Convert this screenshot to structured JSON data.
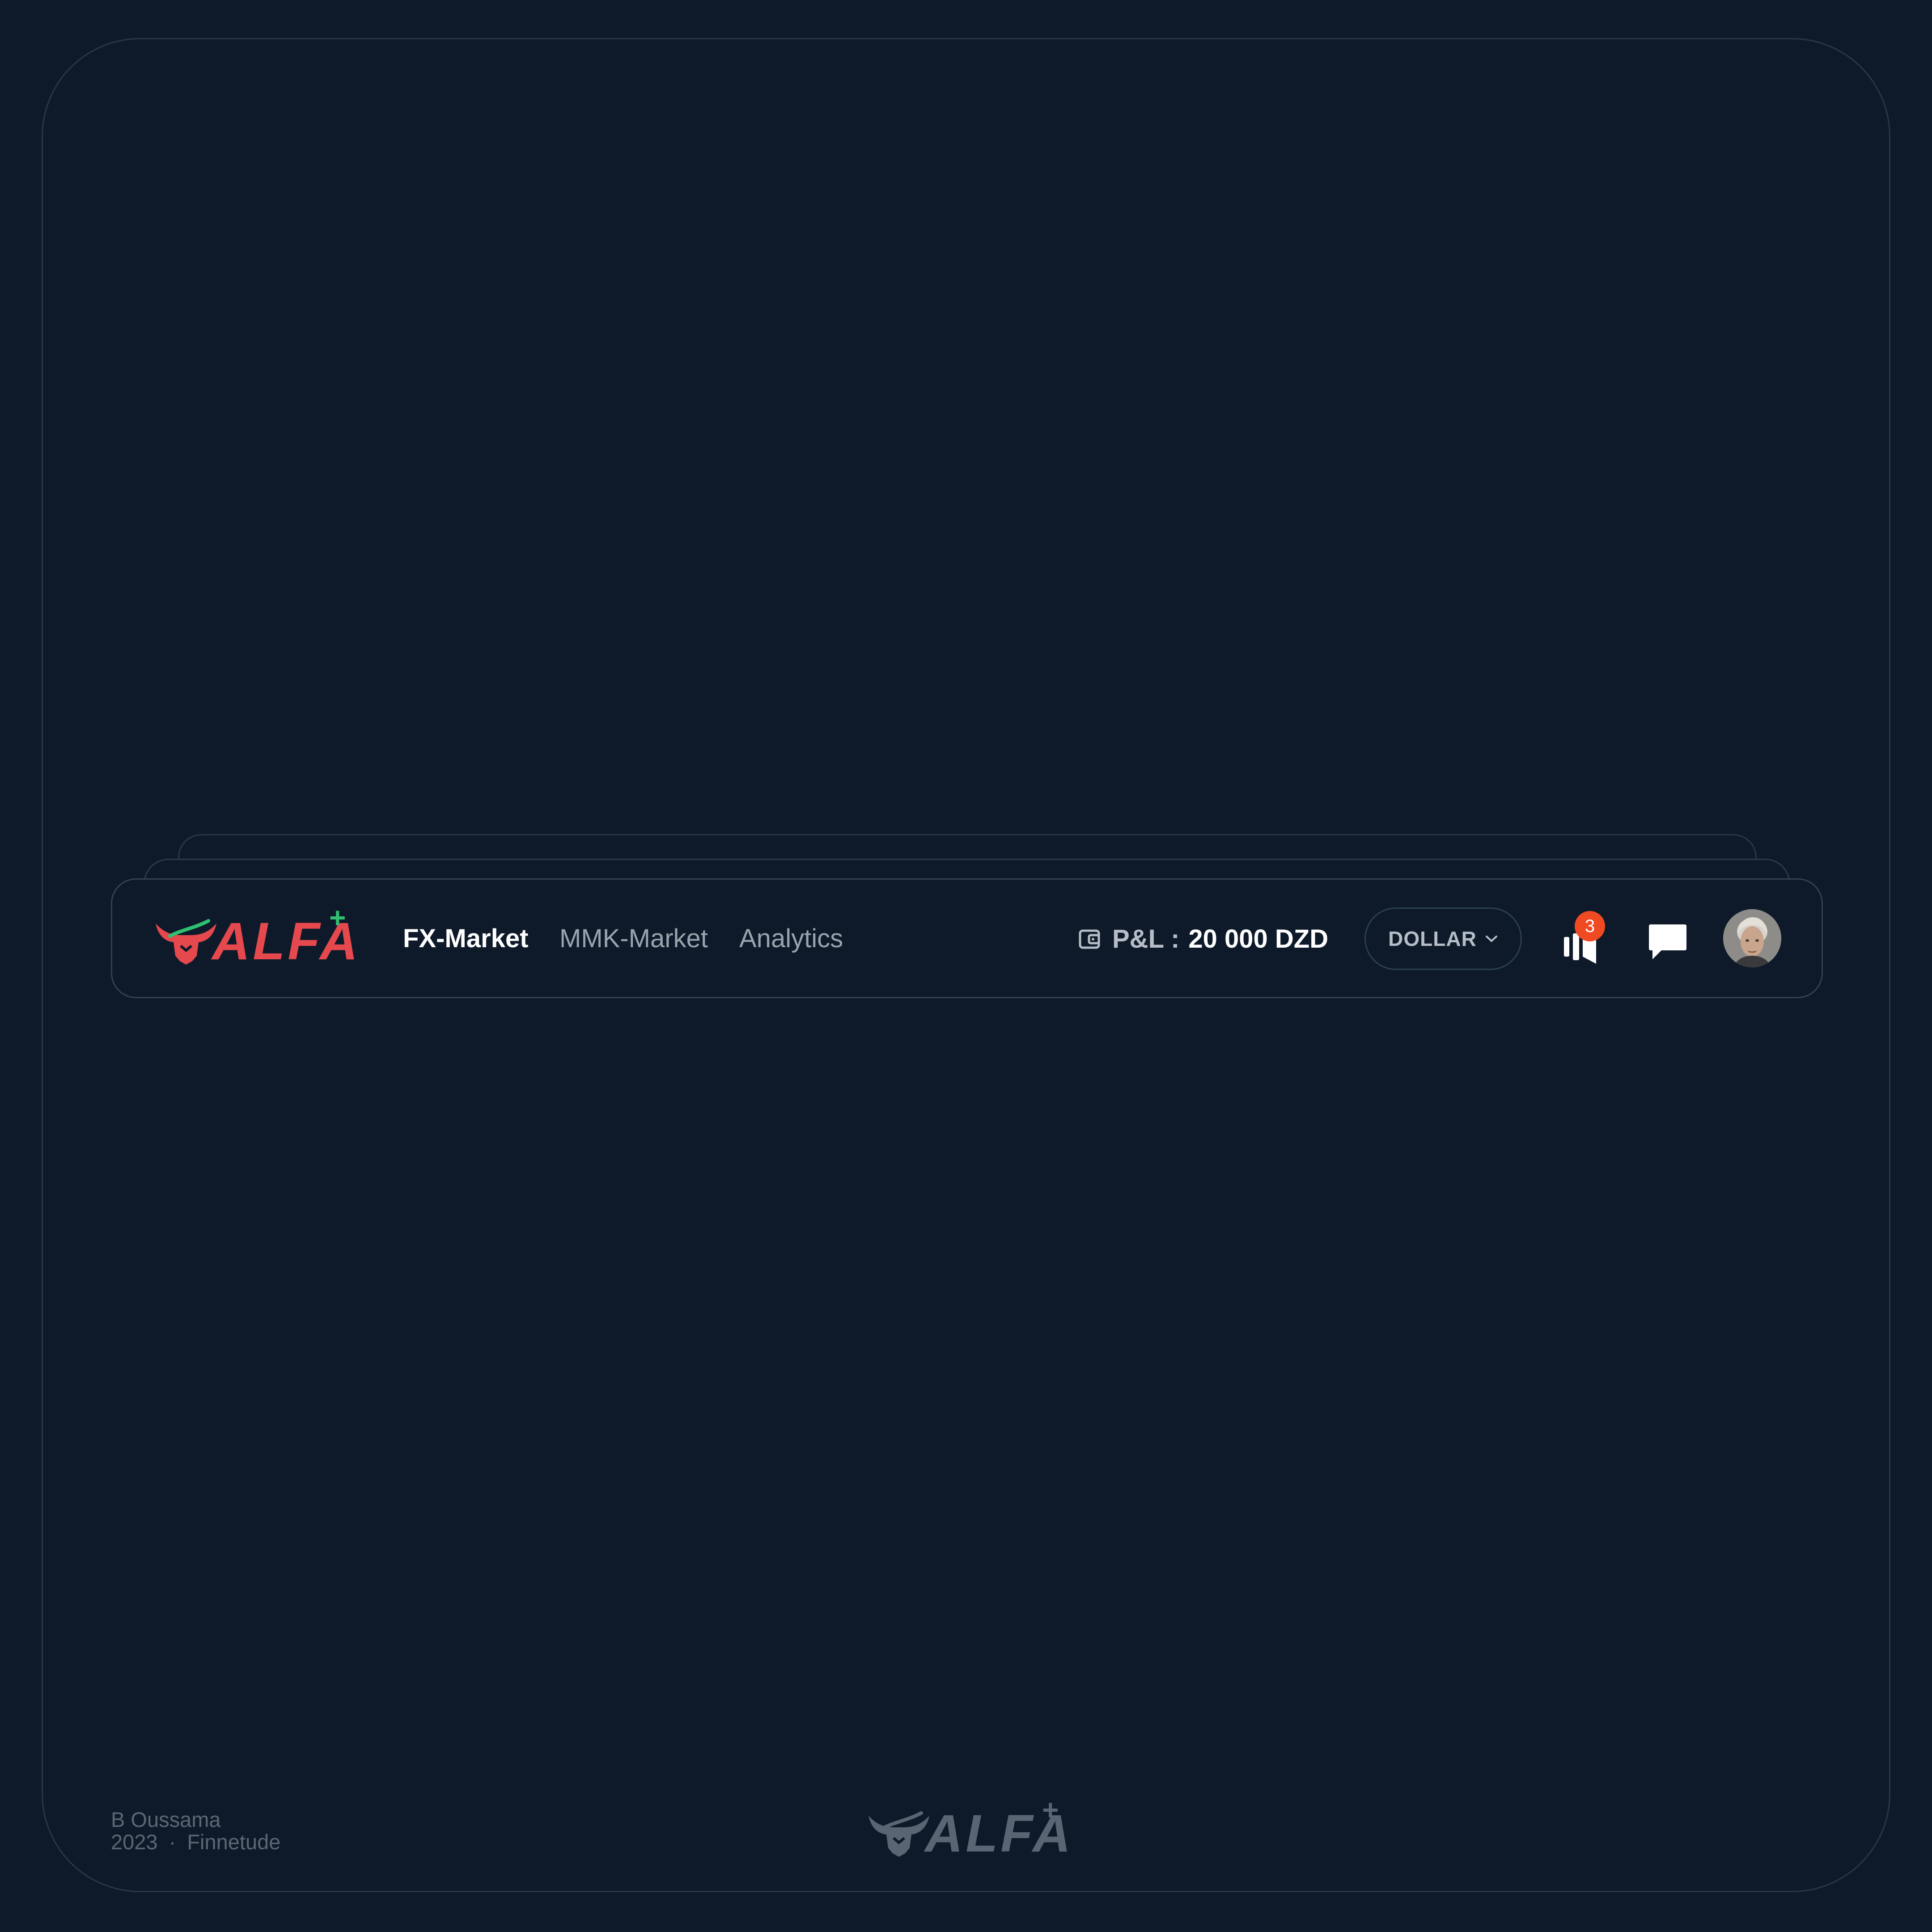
{
  "brand": {
    "name": "ALFA",
    "plus": "+",
    "primary_color": "#e5484d",
    "accent_color": "#2fbf71",
    "muted_color": "#5a6573"
  },
  "nav": {
    "items": [
      {
        "label": "FX-Market",
        "active": true
      },
      {
        "label": "MMK-Market",
        "active": false
      },
      {
        "label": "Analytics",
        "active": false
      }
    ],
    "active_color": "#ffffff",
    "inactive_color": "#9aa3ad"
  },
  "balance": {
    "icon": "wallet-icon",
    "label": "P&L :",
    "value": "20 000 DZD",
    "label_color": "#b6bdc6",
    "value_color": "#ffffff"
  },
  "currency_select": {
    "selected": "DOLLAR",
    "icon": "chevron-down-icon",
    "text_color": "#b6bdc6"
  },
  "notifications": {
    "icon": "megaphone-icon",
    "count": "3",
    "badge_color": "#f04a23"
  },
  "messages": {
    "icon": "chat-bubble-icon"
  },
  "user": {
    "avatar_icon": "user-avatar"
  },
  "footer": {
    "author": "B Oussama",
    "year": "2023",
    "separator": "·",
    "company": "Finnetude",
    "text_color": "#5c6673"
  }
}
